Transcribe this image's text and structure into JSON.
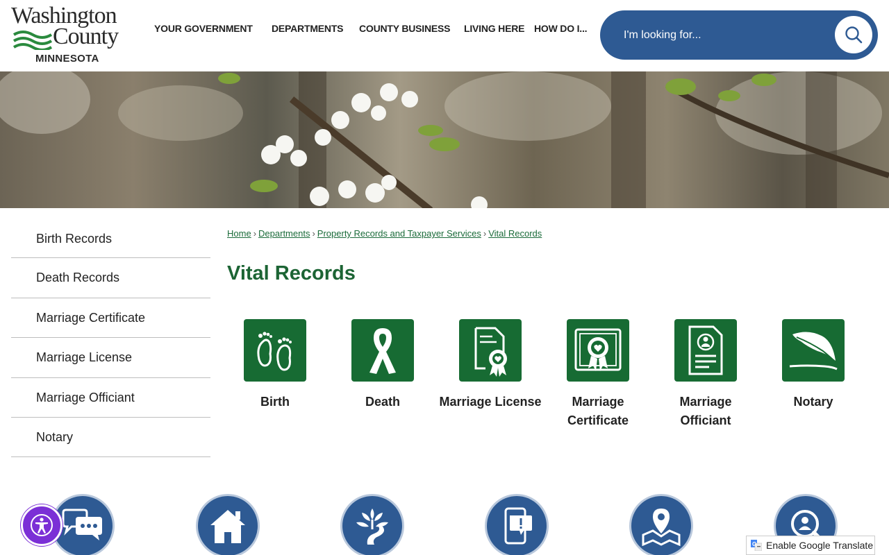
{
  "logo": {
    "line1": "Washington",
    "line2": "County",
    "state": "MINNESOTA"
  },
  "nav": {
    "items": [
      {
        "label": "YOUR GOVERNMENT"
      },
      {
        "label": "DEPARTMENTS"
      },
      {
        "label": "COUNTY BUSINESS"
      },
      {
        "label": "LIVING HERE"
      },
      {
        "label": "HOW DO I..."
      }
    ]
  },
  "search": {
    "placeholder": "I'm looking for...",
    "icon": "search-icon"
  },
  "sidebar": {
    "items": [
      {
        "label": "Birth Records"
      },
      {
        "label": "Death Records"
      },
      {
        "label": "Marriage Certificate"
      },
      {
        "label": "Marriage License"
      },
      {
        "label": "Marriage Officiant"
      },
      {
        "label": "Notary"
      }
    ]
  },
  "breadcrumb": {
    "items": [
      {
        "label": "Home"
      },
      {
        "label": "Departments"
      },
      {
        "label": "Property Records and Taxpayer Services"
      },
      {
        "label": "Vital Records"
      }
    ],
    "separator": "›"
  },
  "main": {
    "title": "Vital Records",
    "tiles": [
      {
        "label": "Birth",
        "icon": "footprints-icon"
      },
      {
        "label": "Death",
        "icon": "ribbon-icon"
      },
      {
        "label": "Marriage License",
        "icon": "license-certificate-icon"
      },
      {
        "label": "Marriage Certificate",
        "icon": "certificate-seal-icon"
      },
      {
        "label": "Marriage Officiant",
        "icon": "officiant-document-icon"
      },
      {
        "label": "Notary",
        "icon": "quill-pen-icon"
      }
    ]
  },
  "bottom_links": {
    "icons": [
      "chat-bubbles-icon",
      "house-icon",
      "tree-path-icon",
      "phone-alert-icon",
      "map-pin-icon",
      "user-search-icon"
    ]
  },
  "accessibility": {
    "icon": "accessibility-icon"
  },
  "translate": {
    "label": "Enable Google Translate",
    "icon": "google-translate-icon"
  },
  "colors": {
    "brand_green": "#176b33",
    "title_green": "#1c6434",
    "brand_blue": "#2e5a93",
    "accessibility_purple": "#7b2fd6"
  }
}
